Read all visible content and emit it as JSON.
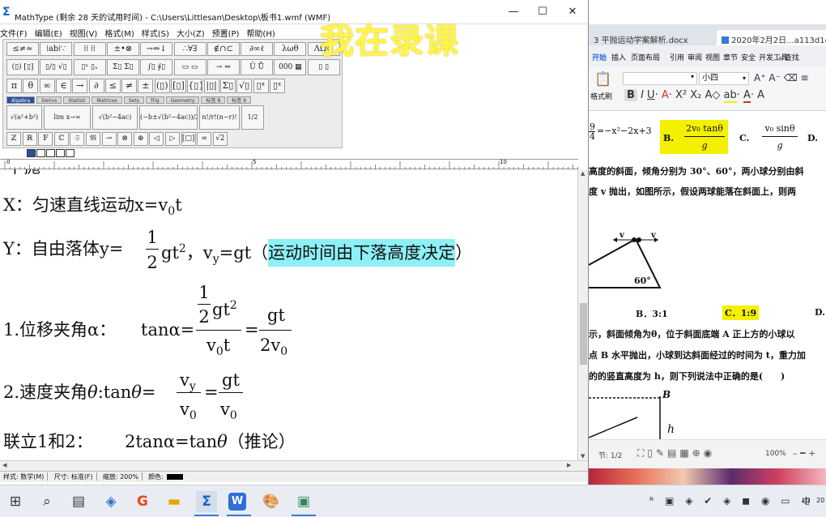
{
  "mathtype": {
    "title": "MathType (剩余 28 天的试用时间) - C:\\Users\\Littlesan\\Desktop\\板书1.wmf (WMF)",
    "menu": [
      "文件(F)",
      "编辑(E)",
      "视图(V)",
      "格式(M)",
      "样式(S)",
      "大小(Z)",
      "预置(P)",
      "帮助(H)"
    ],
    "palette_row1": [
      "≤≠≈",
      "⁞ab⁞∵",
      "⁞⁞ ⁞⁞",
      "±•⊗",
      "→⇔↓",
      "∴∀∃",
      "∉∩⊂",
      "∂∞ℓ",
      "λωθ",
      "ΛΩ⊗"
    ],
    "palette_row2": [
      "(▯) [▯]",
      "▯/▯ √▯",
      "▯ˣ ▯ₓ",
      "Σ▯ Σ▯",
      "∫▯ ∮▯",
      "▭ ▭",
      "→ ⇐",
      "Ū Ů",
      "000 ▦",
      "▯ ▯"
    ],
    "palette_row3": [
      "π",
      "θ",
      "∞",
      "∈",
      "→",
      "∂",
      "≤",
      "≠",
      "±",
      "(▯)",
      "[▯]",
      "{▯}",
      "|▯|",
      "Σ▯",
      "√▯",
      "▯ˣ",
      "▯ˣ"
    ],
    "palette_tabs": [
      "Algebra",
      "Derivs",
      "Statisti",
      "Matrices",
      "Sets",
      "Trig",
      "Geometry",
      "标签 8",
      "标签 9"
    ],
    "palette_templates": [
      "√(a²+b²)",
      "lim x→∞",
      "√(b²−4ac)",
      "(−b±√(b²−4ac))/2a",
      "n!/r!(n−r)!",
      "1/2"
    ],
    "palette_bottom": [
      "ℤ",
      "ℝ",
      "𝔽",
      "ℂ",
      "𝔖",
      "𝔐",
      "→",
      "⊗",
      "⊕",
      "◁",
      "▷",
      "[□]",
      "∞",
      "√2"
    ],
    "ruler_marks": [
      "0",
      "5",
      "10"
    ],
    "doc": {
      "line0": "平抛",
      "line1_prefix": "X：匀速直线运动x=v",
      "line1_sub": "0",
      "line1_suffix": "t",
      "line2_prefix": "Y：自由落体y=",
      "frac_half_num": "1",
      "frac_half_den": "2",
      "line2_gt": "gt",
      "line2_sq": "2",
      "line2_vy": "，v",
      "line2_vy_sub": "y",
      "line2_mid": "=gt（",
      "line2_highlight": "运动时间由下落高度决定",
      "line2_close": "）",
      "line3_prefix": "1.位移夹角α：",
      "line3_tan": "tanα=",
      "line3_num_frac_num": "1",
      "line3_num_frac_den": "2",
      "line3_num_gt": "gt",
      "line3_num_sq": "2",
      "line3_den": "v",
      "line3_den_sub": "0",
      "line3_den_t": "t",
      "line3_eq": "=",
      "line3_r_num": "gt",
      "line3_r_den": "2v",
      "line3_r_den_sub": "0",
      "line4_prefix": "2.速度夹角",
      "line4_theta": "θ",
      "line4_tan": ":tan",
      "line4_eq1": "=",
      "line4_num": "v",
      "line4_num_sub": "y",
      "line4_den": "v",
      "line4_den_sub": "0",
      "line4_eq2": "=",
      "line4_r_num": "gt",
      "line4_r_den": "v",
      "line4_r_den_sub": "0",
      "line5": "联立1和2：",
      "line5_eq": "2tanα=tan",
      "line5_theta": "θ",
      "line5_note": "（推论）"
    },
    "status": {
      "style": "样式: 数学(M)",
      "size": "尺寸: 标准(F)",
      "zoom": "缩放: 200%",
      "color": "颜色:"
    }
  },
  "watermark": "我在录课",
  "wps": {
    "tab1": "3 平抛运动学案解析.docx",
    "tab2": "2020年2月2日...a113d1c",
    "ribbon_tabs": [
      "开始",
      "插入",
      "页面布局",
      "引用",
      "审阅",
      "视图",
      "章节",
      "安全",
      "开发工具"
    ],
    "search": "查找",
    "font_size": "小四",
    "format_painter": "格式刷",
    "doc": {
      "opt_expr": "=−x²−2x+3",
      "opt_expr_frac": "9/4",
      "optB_label": "B.",
      "optB_num": "2v₀ tanθ",
      "optB_den": "g",
      "optC_label": "C.",
      "optC_num": "v₀ sinθ",
      "optC_den": "g",
      "optD_label": "D.",
      "p1": "高度的斜面，倾角分别为 30°、60°，两小球分别由斜",
      "p2": "度 v 抛出，如图所示，假设两球能落在斜面上，则两",
      "fig_v1": "v",
      "fig_v2": "v",
      "fig_angle": "60°",
      "ans_b": "B．3:1",
      "ans_c": "C．1:9",
      "ans_d": "D.",
      "p3": "示，斜面倾角为θ，位于斜面底端 A 正上方的小球以",
      "p4": "点 B 水平抛出，小球到达斜面经过的时间为 t，重力加",
      "p5": "的的竖直高度为 h，则下列说法中正确的是(　　)",
      "fig2_b": "B",
      "fig2_h": "h"
    },
    "status_page": "节: 1/2",
    "status_zoom": "100%"
  },
  "taskbar": {
    "tray_text": "中",
    "clock": "20"
  },
  "colors": {
    "highlight_cyan": "#8ef0f7",
    "highlight_yellow": "#f3f000",
    "watermark": "#fff44a",
    "taskbar_accent": "#3b78d8"
  }
}
